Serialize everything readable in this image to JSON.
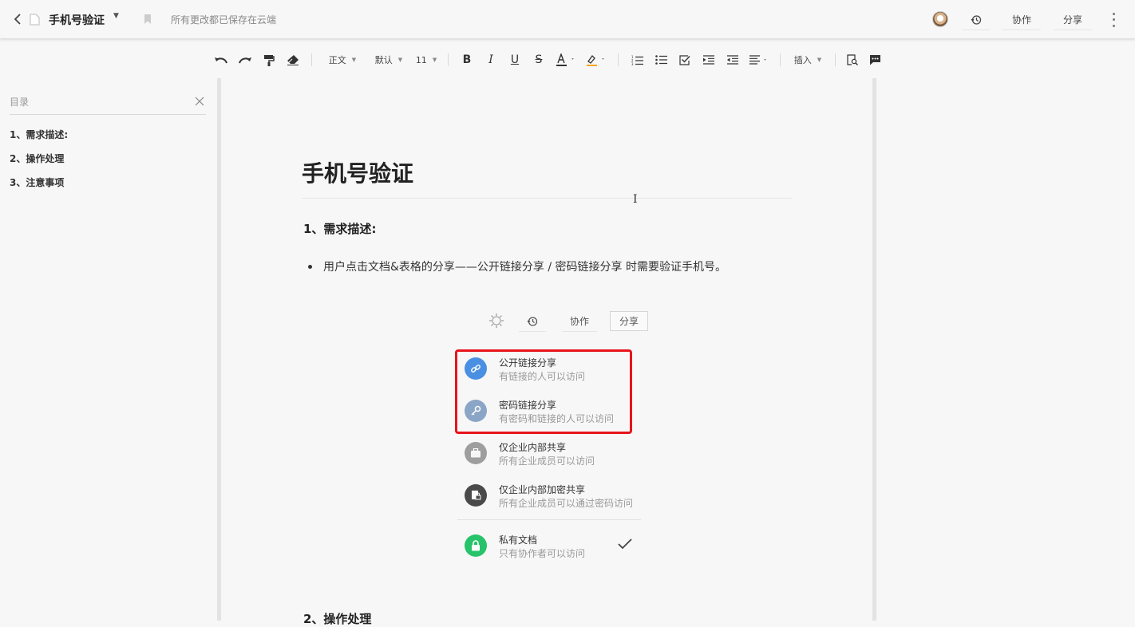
{
  "header": {
    "doc_title": "手机号验证",
    "save_status": "所有更改都已保存在云端",
    "collab_label": "协作",
    "share_label": "分享"
  },
  "toolbar": {
    "style_label": "正文",
    "font_label": "默认",
    "size_label": "11",
    "insert_label": "插入"
  },
  "outline": {
    "title": "目录",
    "items": [
      "1、需求描述:",
      "2、操作处理",
      "3、注意事项"
    ]
  },
  "document": {
    "title": "手机号验证",
    "section1_heading": "1、需求描述:",
    "bullet_text": "用户点击文档&表格的分享——公开链接分享 / 密码链接分享 时需要验证手机号。",
    "section2_heading": "2、操作处理"
  },
  "share_mockup": {
    "collab_label": "协作",
    "share_label": "分享",
    "options": [
      {
        "title": "公开链接分享",
        "subtitle": "有链接的人可以访问",
        "color": "#4a90e2",
        "icon": "link-icon"
      },
      {
        "title": "密码链接分享",
        "subtitle": "有密码和链接的人可以访问",
        "color": "#8aa5c6",
        "icon": "key-icon"
      },
      {
        "title": "仅企业内部共享",
        "subtitle": "所有企业成员可以访问",
        "color": "#9e9e9e",
        "icon": "briefcase-icon"
      },
      {
        "title": "仅企业内部加密共享",
        "subtitle": "所有企业成员可以通过密码访问",
        "color": "#4a4a4a",
        "icon": "lock-doc-icon"
      },
      {
        "title": "私有文档",
        "subtitle": "只有协作者可以访问",
        "color": "#27c36b",
        "icon": "lock-icon"
      }
    ],
    "highlight_color": "#e8141c"
  }
}
